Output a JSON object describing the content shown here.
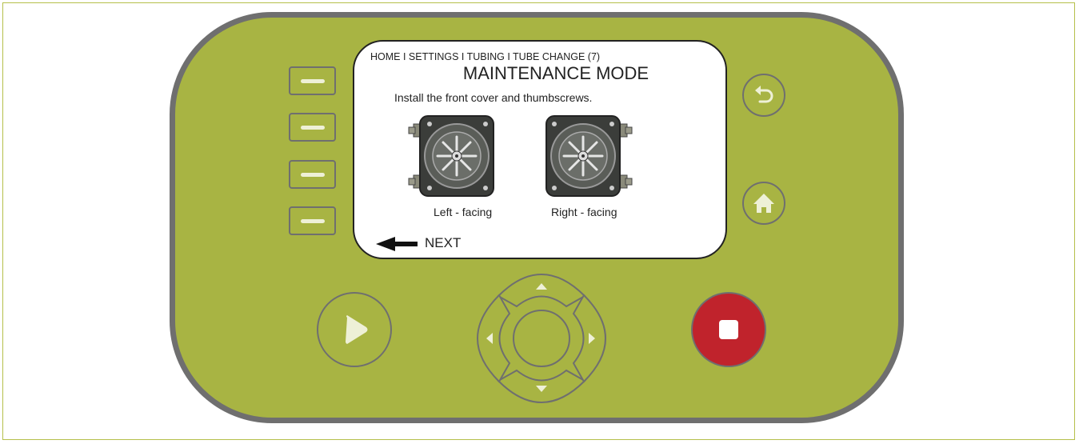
{
  "screen": {
    "breadcrumb": "HOME I SETTINGS I TUBING I TUBE CHANGE (7)",
    "title": "MAINTENANCE MODE",
    "instruction": "Install the front cover and thumbscrews.",
    "left_caption": "Left - facing",
    "right_caption": "Right - facing",
    "next_label": "NEXT"
  },
  "colors": {
    "device_body": "#a8b443",
    "device_border": "#6f6f6f",
    "key_bar": "#eef0d7",
    "stop_button": "#c0232c",
    "screen_background": "#ffffff"
  },
  "controls": {
    "soft_keys": [
      "soft-key-1",
      "soft-key-2",
      "soft-key-3",
      "soft-key-4"
    ],
    "back_icon": "undo-arrow-icon",
    "home_icon": "home-icon",
    "run_icon": "play-icon",
    "stop_icon": "stop-square-icon",
    "dpad": [
      "up-arrow-icon",
      "left-arrow-icon",
      "right-arrow-icon",
      "down-arrow-icon"
    ]
  }
}
